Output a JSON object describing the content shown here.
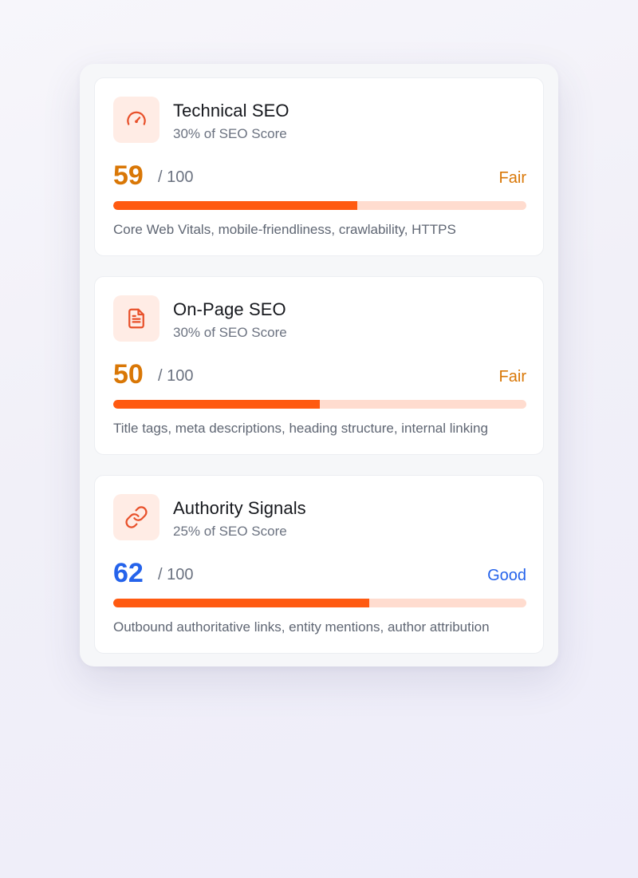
{
  "colors": {
    "fair": "#d97706",
    "good": "#2563eb",
    "bar_fill": "#ff5a11",
    "bar_track": "#ffdccf",
    "icon_bg": "#ffece5",
    "icon_stroke": "#e8502a"
  },
  "cards": [
    {
      "icon": "speedometer-icon",
      "title": "Technical SEO",
      "weight": "30% of SEO Score",
      "score": "59",
      "max": "/ 100",
      "progress": 0.59,
      "rating": "Fair",
      "rating_color": "#d97706",
      "description": "Core Web Vitals, mobile-friendliness, crawlability, HTTPS"
    },
    {
      "icon": "document-icon",
      "title": "On-Page SEO",
      "weight": "30% of SEO Score",
      "score": "50",
      "max": "/ 100",
      "progress": 0.5,
      "rating": "Fair",
      "rating_color": "#d97706",
      "description": "Title tags, meta descriptions, heading structure, internal linking"
    },
    {
      "icon": "link-icon",
      "title": "Authority Signals",
      "weight": "25% of SEO Score",
      "score": "62",
      "max": "/ 100",
      "progress": 0.62,
      "rating": "Good",
      "rating_color": "#2563eb",
      "description": "Outbound authoritative links, entity mentions, author attribution"
    }
  ]
}
